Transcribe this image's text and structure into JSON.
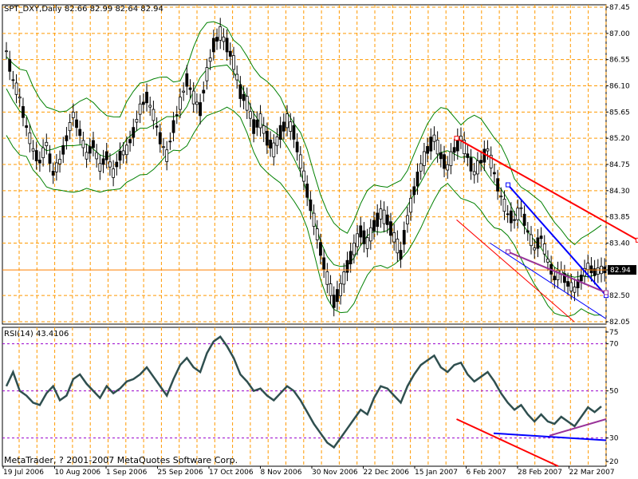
{
  "app": {
    "symbol_header": "SPT_DXY,Daily",
    "ohlc_header": "82.66 82.99 82.64 82.94",
    "indicator_header": "RSI(14) 43.4106",
    "copyright": "MetaTrader, ? 2001-2007 MetaQuotes Software Corp.",
    "current_price_label": "82.94"
  },
  "colors": {
    "background": "#ffffff",
    "grid": "#ff9900",
    "candles": "#000000",
    "bands": "#008000",
    "rsi_line": "#2f4f4f",
    "rsi_levels": "#9900cc",
    "price_line": "#ff8000",
    "trend_red": "#ff0000",
    "trend_blue": "#0000ff",
    "trend_purple": "#993399"
  },
  "chart_data": [
    {
      "type": "candlestick",
      "panel": "price",
      "title": "SPT_DXY,Daily",
      "y_ticks": [
        "87.45",
        "87.00",
        "86.55",
        "86.10",
        "85.65",
        "85.20",
        "84.75",
        "84.30",
        "83.85",
        "83.40",
        "82.94",
        "82.50",
        "82.05"
      ],
      "ylim": [
        82.05,
        87.45
      ],
      "x_ticks": [
        "19 Jul 2006",
        "10 Aug 2006",
        "1 Sep 2006",
        "25 Sep 2006",
        "17 Oct 2006",
        "8 Nov 2006",
        "30 Nov 2006",
        "22 Dec 2006",
        "15 Jan 2007",
        "6 Feb 2007",
        "28 Feb 2007",
        "22 Mar 2007"
      ],
      "last_close": 82.94,
      "close_path": [
        86.7,
        86.2,
        85.9,
        85.4,
        85.0,
        84.8,
        85.1,
        84.6,
        84.8,
        85.2,
        85.6,
        85.3,
        84.9,
        85.1,
        84.7,
        84.9,
        84.6,
        84.9,
        85.0,
        85.3,
        85.7,
        85.9,
        85.6,
        85.2,
        84.9,
        85.4,
        85.8,
        86.2,
        85.9,
        85.7,
        86.3,
        86.8,
        87.0,
        86.8,
        86.5,
        86.0,
        85.8,
        85.4,
        85.5,
        85.2,
        85.0,
        85.3,
        85.5,
        85.3,
        84.8,
        84.3,
        83.8,
        83.3,
        82.8,
        82.4,
        82.6,
        83.0,
        83.3,
        83.6,
        83.4,
        83.7,
        83.9,
        83.8,
        83.5,
        83.2,
        83.8,
        84.3,
        84.7,
        85.0,
        85.2,
        84.9,
        84.7,
        85.0,
        85.2,
        84.9,
        84.6,
        84.8,
        85.0,
        84.6,
        84.2,
        83.9,
        83.8,
        84.0,
        83.6,
        83.3,
        83.5,
        83.1,
        82.8,
        82.9,
        82.7,
        82.6,
        82.8,
        83.0,
        82.9,
        82.94
      ],
      "series": [
        {
          "name": "red channel upper",
          "points": [
            {
              "x": "6 Feb 2007",
              "y": 85.2
            },
            {
              "x": "28 Mar 2007",
              "y": 83.45
            }
          ]
        },
        {
          "name": "blue channel upper",
          "points": [
            {
              "x": "28 Feb 2007",
              "y": 84.4
            },
            {
              "x": "30 Mar 2007",
              "y": 82.5
            }
          ]
        },
        {
          "name": "purple channel",
          "points": [
            {
              "x": "28 Feb 2007",
              "y": 83.25
            },
            {
              "x": "30 Mar 2007",
              "y": 82.55
            }
          ]
        }
      ]
    },
    {
      "type": "line",
      "panel": "indicator",
      "title": "RSI(14) 43.4106",
      "y_ticks": [
        "75",
        "70",
        "50",
        "30",
        "20"
      ],
      "levels": [
        70,
        50,
        30
      ],
      "ylim": [
        20,
        75
      ],
      "last_value": 43.4106,
      "values": [
        52,
        58,
        50,
        48,
        45,
        44,
        49,
        52,
        46,
        48,
        55,
        57,
        53,
        50,
        47,
        52,
        49,
        51,
        54,
        55,
        57,
        60,
        56,
        52,
        48,
        55,
        61,
        64,
        60,
        58,
        66,
        71,
        73,
        69,
        64,
        57,
        54,
        50,
        51,
        48,
        46,
        49,
        52,
        50,
        46,
        41,
        36,
        32,
        28,
        26,
        30,
        34,
        38,
        42,
        40,
        47,
        52,
        51,
        48,
        45,
        52,
        57,
        61,
        63,
        65,
        60,
        58,
        61,
        62,
        57,
        54,
        56,
        58,
        54,
        49,
        45,
        42,
        44,
        40,
        37,
        40,
        37,
        36,
        39,
        37,
        35,
        39,
        43,
        41,
        43.4
      ]
    }
  ]
}
